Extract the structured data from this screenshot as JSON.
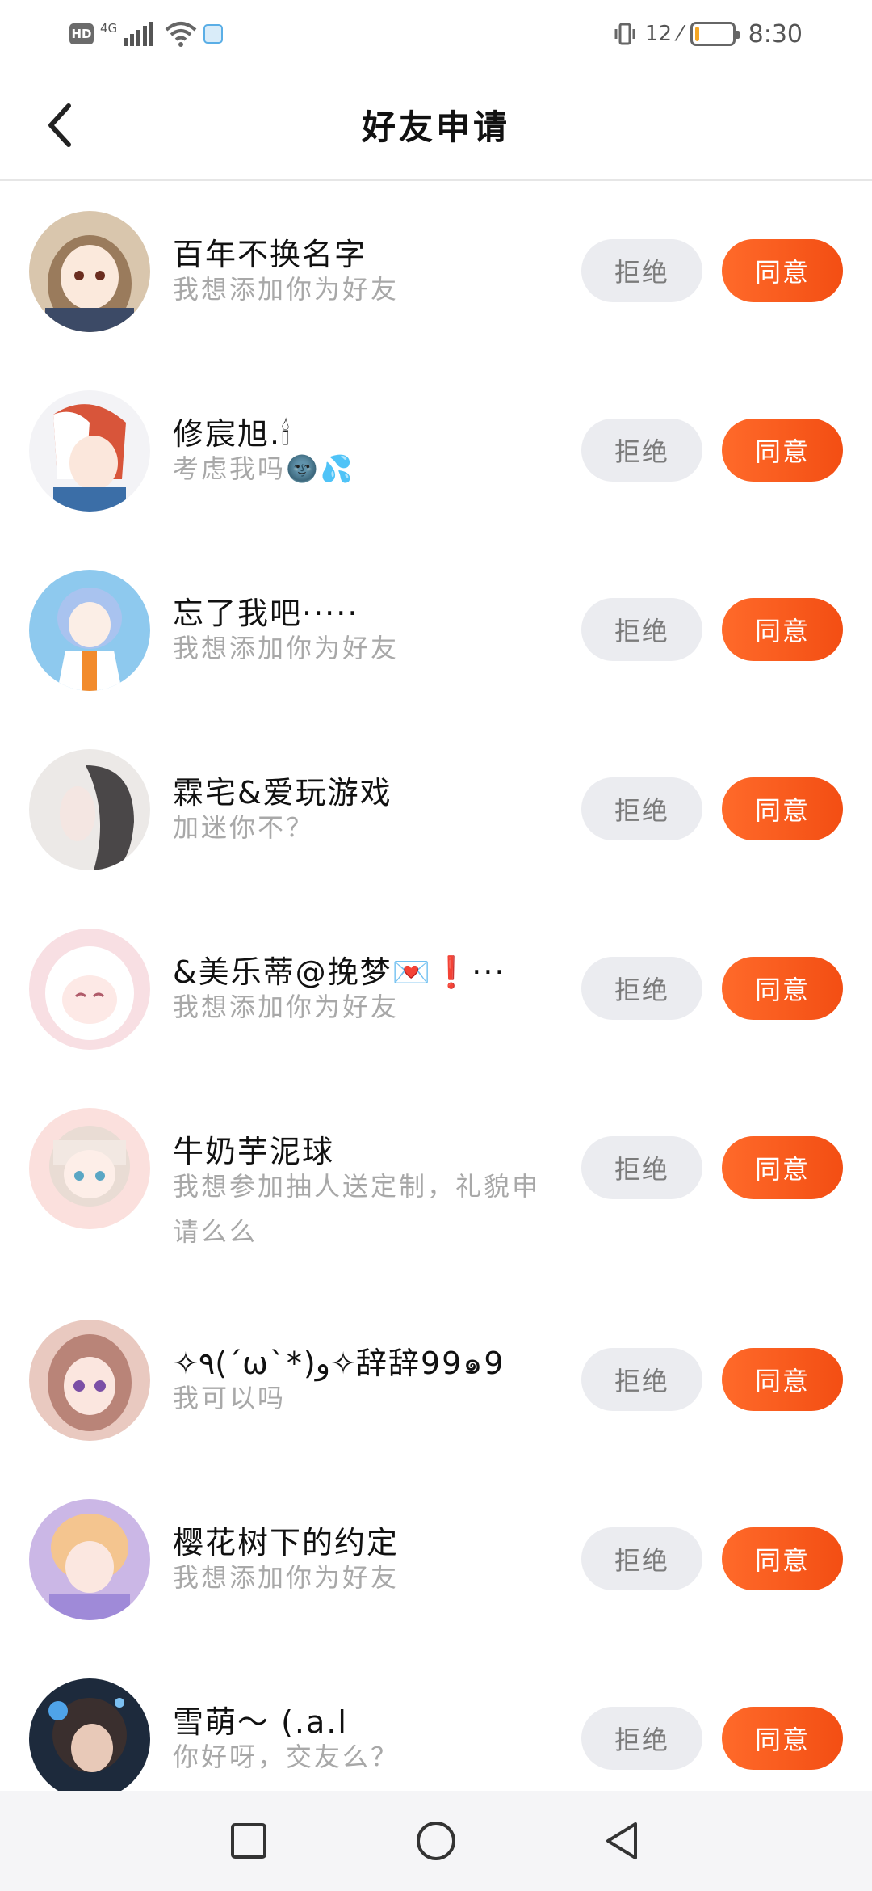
{
  "status_bar": {
    "hd_label": "HD",
    "network_label": "4G",
    "battery_percent": "12",
    "battery_level": 0.12,
    "time": "8:30"
  },
  "header": {
    "title": "好友申请"
  },
  "buttons": {
    "reject": "拒绝",
    "accept": "同意"
  },
  "requests": [
    {
      "name": "百年不换名字",
      "message": "我想添加你为好友",
      "avatar": "anime-girl-brown-hair"
    },
    {
      "name": "修宸旭.🕯",
      "message": "考虑我吗🌚💦",
      "avatar": "anime-boy-red-white-hair"
    },
    {
      "name": "忘了我吧·····",
      "message": "我想添加你为好友",
      "avatar": "anime-girl-blue-hair"
    },
    {
      "name": "霖宅&爱玩游戏",
      "message": "加迷你不？",
      "avatar": "girl-sketch-grey"
    },
    {
      "name": "&美乐蒂@挽梦💌❗···",
      "message": "我想添加你为好友",
      "avatar": "anime-girl-pink"
    },
    {
      "name": "牛奶芋泥球",
      "message": "我想参加抽人送定制，礼貌申请么么",
      "avatar": "anime-girl-bangs"
    },
    {
      "name": "✧٩(ˊωˋ*)و✧辞辞99๑9",
      "message": "我可以吗",
      "avatar": "anime-girl-purple-eyes"
    },
    {
      "name": "樱花树下的约定",
      "message": "我想添加你为好友",
      "avatar": "anime-boy-blonde"
    },
    {
      "name": "雪萌～ (.a.l",
      "message": "你好呀，交友么？",
      "avatar": "anime-dark-blue"
    }
  ],
  "nav_bar": {
    "recents_icon": "square-icon",
    "home_icon": "circle-icon",
    "back_icon": "triangle-back-icon"
  }
}
